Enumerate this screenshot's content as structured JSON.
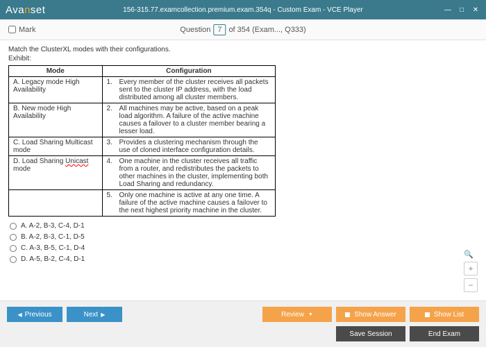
{
  "window": {
    "logo_pre": "Ava",
    "logo_n": "n",
    "logo_post": "set",
    "title": "156-315.77.examcollection.premium.exam.354q - Custom Exam - VCE Player"
  },
  "qbar": {
    "mark": "Mark",
    "question_label": "Question",
    "current": "7",
    "total_text": "of 354 (Exam..., Q333)"
  },
  "prompt": "Match the ClusterXL modes with their configurations.",
  "exhibit_label": "Exhibit:",
  "table": {
    "head_mode": "Mode",
    "head_cfg": "Configuration",
    "rows": [
      {
        "mode": "A. Legacy mode High Availability",
        "num": "1.",
        "cfg": "Every member of the cluster receives all packets sent to the cluster IP address, with the load distributed among all cluster members."
      },
      {
        "mode": "B. New mode High Availability",
        "num": "2.",
        "cfg": "All machines may be active, based on a peak load algorithm. A failure of the active machine causes a failover to a cluster member bearing a lesser load."
      },
      {
        "mode": "C. Load Sharing Multicast mode",
        "num": "3.",
        "cfg": "Provides a clustering mechanism through the use of cloned interface configuration details."
      },
      {
        "mode": "D. Load Sharing Unicast mode",
        "num": "4.",
        "cfg": "One machine in the cluster receives all traffic from a router, and redistributes the packets to other machines in the cluster, implementing both Load Sharing and redundancy."
      },
      {
        "mode": "",
        "num": "5.",
        "cfg": "Only one machine is active at any one time. A failure of the active machine causes a failover to the next highest priority machine in the cluster."
      }
    ]
  },
  "options": [
    "A.   A-2, B-3, C-4, D-1",
    "B.   A-2, B-3, C-1, D-5",
    "C.   A-3, B-5, C-1, D-4",
    "D.   A-5, B-2, C-4, D-1"
  ],
  "footer": {
    "previous": "Previous",
    "next": "Next",
    "review": "Review",
    "show_answer": "Show Answer",
    "show_list": "Show List",
    "save_session": "Save Session",
    "end_exam": "End Exam"
  }
}
